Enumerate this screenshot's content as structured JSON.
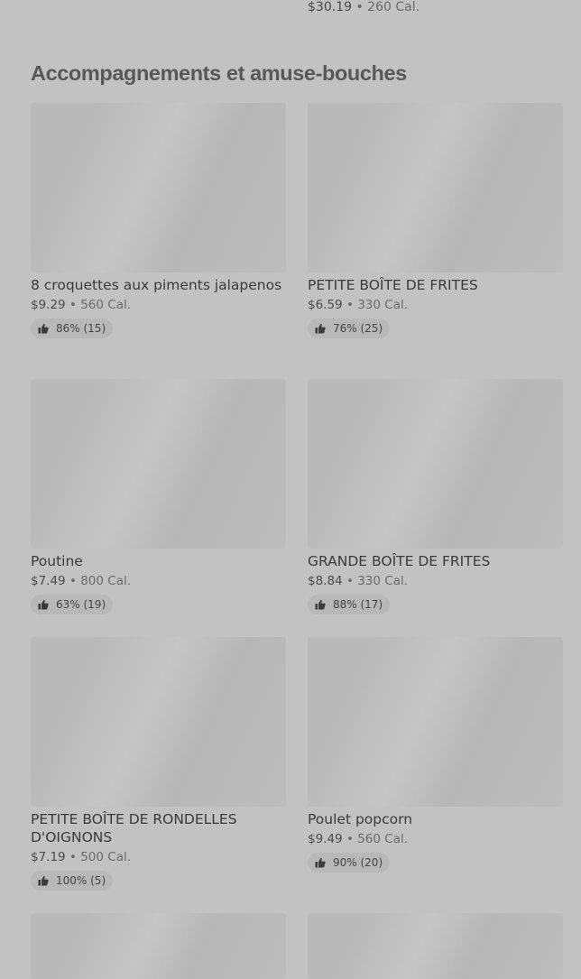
{
  "previous_item": {
    "price": "$30.19",
    "separator": " • ",
    "calories": "260 Cal."
  },
  "section": {
    "title": "Accompagnements et amuse-bouches"
  },
  "items": [
    {
      "name": "8 croquettes aux piments jalapenos",
      "price": "$9.29",
      "separator": " • ",
      "calories": "560 Cal.",
      "rating": "86% (15)"
    },
    {
      "name": "PETITE BOÎTE DE FRITES",
      "price": "$6.59",
      "separator": " • ",
      "calories": "330 Cal.",
      "rating": "76% (25)"
    },
    {
      "name": "Poutine",
      "price": "$7.49",
      "separator": " • ",
      "calories": "800 Cal.",
      "rating": "63% (19)"
    },
    {
      "name": "GRANDE BOÎTE DE FRITES",
      "price": "$8.84",
      "separator": " • ",
      "calories": "330 Cal.",
      "rating": "88% (17)"
    },
    {
      "name": "PETITE BOÎTE DE RONDELLES D'OIGNONS",
      "price": "$7.19",
      "separator": " • ",
      "calories": "500 Cal.",
      "rating": "100% (5)"
    },
    {
      "name": "Poulet popcorn",
      "price": "$9.49",
      "separator": " • ",
      "calories": "560 Cal.",
      "rating": "90% (20)"
    }
  ],
  "icons": {
    "rating": "thumbs-up-icon"
  }
}
